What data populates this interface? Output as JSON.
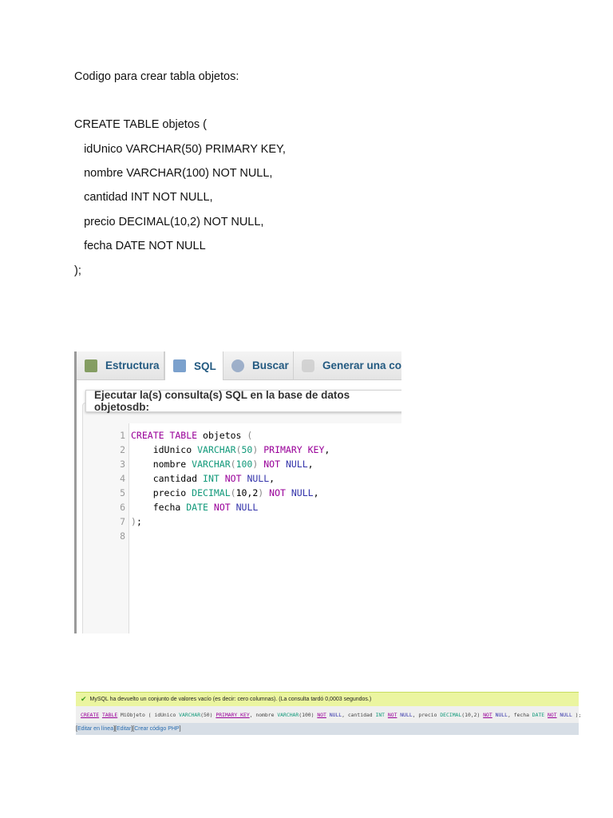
{
  "doc": {
    "intro": "Codigo para crear tabla objetos:",
    "code_lines": [
      "CREATE TABLE objetos (",
      "   idUnico VARCHAR(50) PRIMARY KEY,",
      "   nombre VARCHAR(100) NOT NULL,",
      "   cantidad INT NOT NULL,",
      "   precio DECIMAL(10,2) NOT NULL,",
      "   fecha DATE NOT NULL",
      ");"
    ]
  },
  "phpmyadmin": {
    "tabs": [
      {
        "label": "Estructura",
        "icon": "structure-icon"
      },
      {
        "label": "SQL",
        "icon": "sql-scroll-icon"
      },
      {
        "label": "Buscar",
        "icon": "search-icon"
      },
      {
        "label": "Generar una con",
        "icon": "database-icon"
      }
    ],
    "query_header": "Ejecutar la(s) consulta(s) SQL en la base de datos objetosdb:",
    "line_numbers": [
      "1",
      "2",
      "3",
      "4",
      "5",
      "6",
      "7",
      "8"
    ],
    "editor_lines": [
      [
        [
          "kw",
          "CREATE TABLE"
        ],
        [
          "plain",
          " objetos "
        ],
        [
          "punct",
          "("
        ]
      ],
      [
        [
          "plain",
          "    idUnico "
        ],
        [
          "type",
          "VARCHAR"
        ],
        [
          "punct",
          "("
        ],
        [
          "type",
          "50"
        ],
        [
          "punct",
          ")"
        ],
        [
          "plain",
          " "
        ],
        [
          "kw",
          "PRIMARY KEY"
        ],
        [
          "plain",
          ","
        ]
      ],
      [
        [
          "plain",
          "    nombre "
        ],
        [
          "type",
          "VARCHAR"
        ],
        [
          "punct",
          "("
        ],
        [
          "type",
          "100"
        ],
        [
          "punct",
          ")"
        ],
        [
          "plain",
          " "
        ],
        [
          "kw",
          "NOT"
        ],
        [
          "plain",
          " "
        ],
        [
          "null",
          "NULL"
        ],
        [
          "plain",
          ","
        ]
      ],
      [
        [
          "plain",
          "    cantidad "
        ],
        [
          "type",
          "INT"
        ],
        [
          "plain",
          " "
        ],
        [
          "kw",
          "NOT"
        ],
        [
          "plain",
          " "
        ],
        [
          "null",
          "NULL"
        ],
        [
          "plain",
          ","
        ]
      ],
      [
        [
          "plain",
          "    precio "
        ],
        [
          "type",
          "DECIMAL"
        ],
        [
          "punct",
          "("
        ],
        [
          "plain",
          "10,2"
        ],
        [
          "punct",
          ")"
        ],
        [
          "plain",
          " "
        ],
        [
          "kw",
          "NOT"
        ],
        [
          "plain",
          " "
        ],
        [
          "null",
          "NULL"
        ],
        [
          "plain",
          ","
        ]
      ],
      [
        [
          "plain",
          "    fecha "
        ],
        [
          "type",
          "DATE"
        ],
        [
          "plain",
          " "
        ],
        [
          "kw",
          "NOT"
        ],
        [
          "plain",
          " "
        ],
        [
          "null",
          "NULL"
        ]
      ],
      [
        [
          "punct",
          ")"
        ],
        [
          "plain",
          ";"
        ]
      ],
      []
    ]
  },
  "result": {
    "message": "MySQL ha devuelto un conjunto de valores vacío (es decir: cero columnas). (La consulta tardó 0,0003 segundos.)",
    "sql": [
      [
        "kw",
        "CREATE"
      ],
      [
        "plain",
        " "
      ],
      [
        "kw",
        "TABLE"
      ],
      [
        "plain",
        " MiObjeto ( idUnico "
      ],
      [
        "type",
        "VARCHAR"
      ],
      [
        "plain",
        "(50) "
      ],
      [
        "kw",
        "PRIMARY KEY"
      ],
      [
        "plain",
        ", nombre "
      ],
      [
        "type",
        "VARCHAR"
      ],
      [
        "plain",
        "(100) "
      ],
      [
        "kw",
        "NOT"
      ],
      [
        "plain",
        " "
      ],
      [
        "null",
        "NULL"
      ],
      [
        "plain",
        ", cantidad "
      ],
      [
        "type",
        "INT"
      ],
      [
        "plain",
        " "
      ],
      [
        "kw",
        "NOT"
      ],
      [
        "plain",
        " "
      ],
      [
        "null",
        "NULL"
      ],
      [
        "plain",
        ", precio "
      ],
      [
        "type",
        "DECIMAL"
      ],
      [
        "plain",
        "(10,2) "
      ],
      [
        "kw",
        "NOT"
      ],
      [
        "plain",
        " "
      ],
      [
        "null",
        "NULL"
      ],
      [
        "plain",
        ", fecha "
      ],
      [
        "type",
        "DATE"
      ],
      [
        "plain",
        " "
      ],
      [
        "kw",
        "NOT"
      ],
      [
        "plain",
        " "
      ],
      [
        "null",
        "NULL"
      ],
      [
        "plain",
        " );"
      ]
    ],
    "links": [
      "Editar en línea",
      "Editar",
      "Crear código PHP"
    ]
  }
}
